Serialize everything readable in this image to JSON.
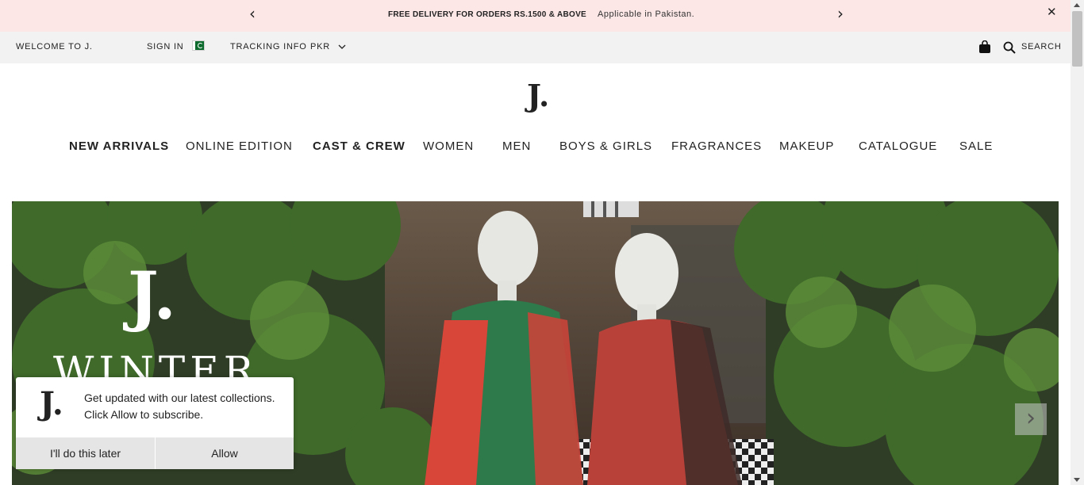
{
  "promo": {
    "prev_icon": "chevron-left",
    "next_icon": "chevron-right",
    "headline": "FREE DELIVERY FOR ORDERS RS.1500 & ABOVE",
    "subline": "Applicable in Pakistan.",
    "close_icon": "close"
  },
  "utility": {
    "welcome": "WELCOME TO J.",
    "sign_in": "SIGN IN",
    "flag_icon": "pakistan-flag",
    "tracking": "TRACKING INFO",
    "currency": "PKR",
    "cart_icon": "shopping-bag",
    "search_icon": "search",
    "search_label": "SEARCH"
  },
  "brand": {
    "logo": "J."
  },
  "nav": {
    "items": [
      {
        "label": "NEW ARRIVALS"
      },
      {
        "label": "ONLINE EDITION"
      },
      {
        "label": "CAST & CREW"
      },
      {
        "label": "WOMEN"
      },
      {
        "label": "MEN"
      },
      {
        "label": "BOYS & GIRLS"
      },
      {
        "label": "FRAGRANCES"
      },
      {
        "label": "MAKEUP"
      },
      {
        "label": "CATALOGUE"
      },
      {
        "label": "SALE"
      }
    ]
  },
  "hero": {
    "logo": "J.",
    "headline": "WINTER",
    "next_icon": "chevron-right"
  },
  "popup": {
    "logo": "J.",
    "message": "Get updated with our latest collections. Click Allow to subscribe.",
    "later_button": "I'll do this later",
    "allow_button": "Allow"
  }
}
